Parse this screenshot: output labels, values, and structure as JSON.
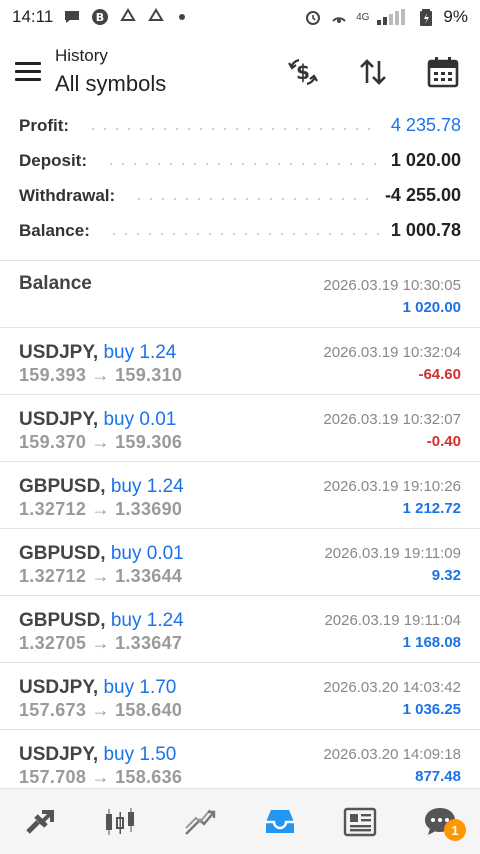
{
  "status_bar": {
    "time": "14:11",
    "battery": "9%",
    "network": "4G"
  },
  "header": {
    "subtitle": "History",
    "title": "All symbols",
    "icons": [
      "dollar-exchange-icon",
      "sort-icon",
      "calendar-icon"
    ]
  },
  "summary": [
    {
      "label": "Profit:",
      "value": "4 235.78",
      "color": "#1a73e8"
    },
    {
      "label": "Deposit:",
      "value": "1 020.00"
    },
    {
      "label": "Withdrawal:",
      "value": "-4 255.00"
    },
    {
      "label": "Balance:",
      "value": "1 000.78"
    }
  ],
  "balance_entry": {
    "label": "Balance",
    "time": "2026.03.19 10:30:05",
    "amount": "1 020.00"
  },
  "deals": [
    {
      "symbol": "USDJPY,",
      "side": "buy 1.24",
      "prices": "159.393 → 159.310",
      "time": "2026.03.19 10:32:04",
      "profit": "-64.60",
      "positive": false
    },
    {
      "symbol": "USDJPY,",
      "side": "buy 0.01",
      "prices": "159.370 → 159.306",
      "time": "2026.03.19 10:32:07",
      "profit": "-0.40",
      "positive": false
    },
    {
      "symbol": "GBPUSD,",
      "side": "buy 1.24",
      "prices": "1.32712 → 1.33690",
      "time": "2026.03.19 19:10:26",
      "profit": "1 212.72",
      "positive": true
    },
    {
      "symbol": "GBPUSD,",
      "side": "buy 0.01",
      "prices": "1.32712 → 1.33644",
      "time": "2026.03.19 19:11:09",
      "profit": "9.32",
      "positive": true
    },
    {
      "symbol": "GBPUSD,",
      "side": "buy 1.24",
      "prices": "1.32705 → 1.33647",
      "time": "2026.03.19 19:11:04",
      "profit": "1 168.08",
      "positive": true
    },
    {
      "symbol": "USDJPY,",
      "side": "buy 1.70",
      "prices": "157.673 → 158.640",
      "time": "2026.03.20 14:03:42",
      "profit": "1 036.25",
      "positive": true
    },
    {
      "symbol": "USDJPY,",
      "side": "buy 1.50",
      "prices": "157.708 → 158.636",
      "time": "2026.03.20 14:09:18",
      "profit": "877.48",
      "positive": true
    }
  ],
  "bottom_nav": {
    "items": [
      "quotes-icon",
      "chart-icon",
      "trade-icon",
      "history-icon",
      "news-icon",
      "messages-icon"
    ],
    "active": "history-icon",
    "messages_badge": "1",
    "active_color": "#2196f3"
  }
}
